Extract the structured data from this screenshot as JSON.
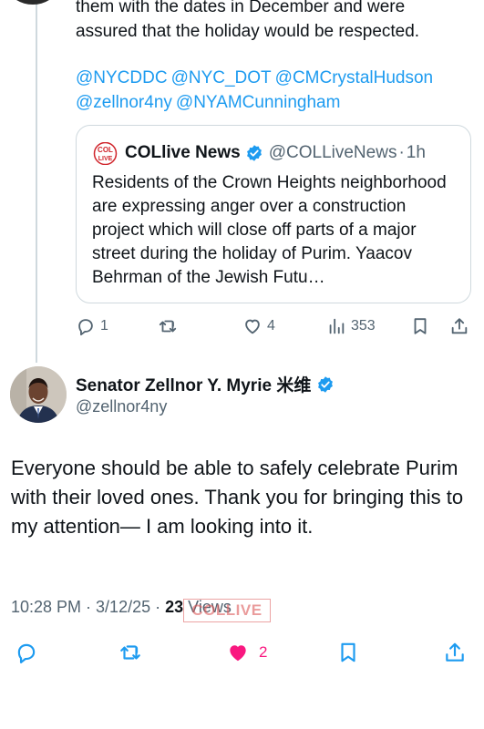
{
  "reply_tweet": {
    "text_lines": [
      "them with the dates in December and were",
      "assured that the holiday would be respected."
    ],
    "mentions": [
      "@NYCDDC",
      "@NYC_DOT",
      "@CMCrystalHudson",
      "@zellnor4ny",
      "@NYAMCunningham"
    ]
  },
  "quote": {
    "logo_text": "COL LIVE",
    "name": "COLlive News",
    "handle": "@COLLiveNews",
    "separator": "·",
    "time": "1h",
    "body": "Residents of the Crown Heights neighborhood are expressing anger over a construction project which will close off parts of a major street during the holiday of Purim. Yaacov Behrman of the Jewish Futu…"
  },
  "reply_actions": {
    "replies": "1",
    "likes": "4",
    "views": "353",
    "icons": [
      "reply-icon",
      "retweet-icon",
      "like-icon",
      "views-icon",
      "bookmark-icon",
      "share-icon"
    ]
  },
  "main_tweet": {
    "author_name": "Senator Zellnor Y. Myrie 米维",
    "author_handle": "@zellnor4ny",
    "text": "Everyone should be able to safely celebrate Purim with their loved ones. Thank you for bringing this to my attention— I am looking into it.",
    "time": "10:28 PM",
    "date": "3/12/25",
    "separator": " · ",
    "views_count": "23",
    "views_label": " Views",
    "likes": "2",
    "icons": [
      "reply-icon",
      "retweet-icon",
      "liked-heart-icon",
      "bookmark-icon",
      "share-icon"
    ]
  },
  "watermark_text": "COLLIVE",
  "colors": {
    "link": "#1d9bf0",
    "muted": "#536471",
    "text": "#0f1419",
    "like_active": "#f91880",
    "verified": "#1d9bf0",
    "border": "#cfd9de"
  }
}
